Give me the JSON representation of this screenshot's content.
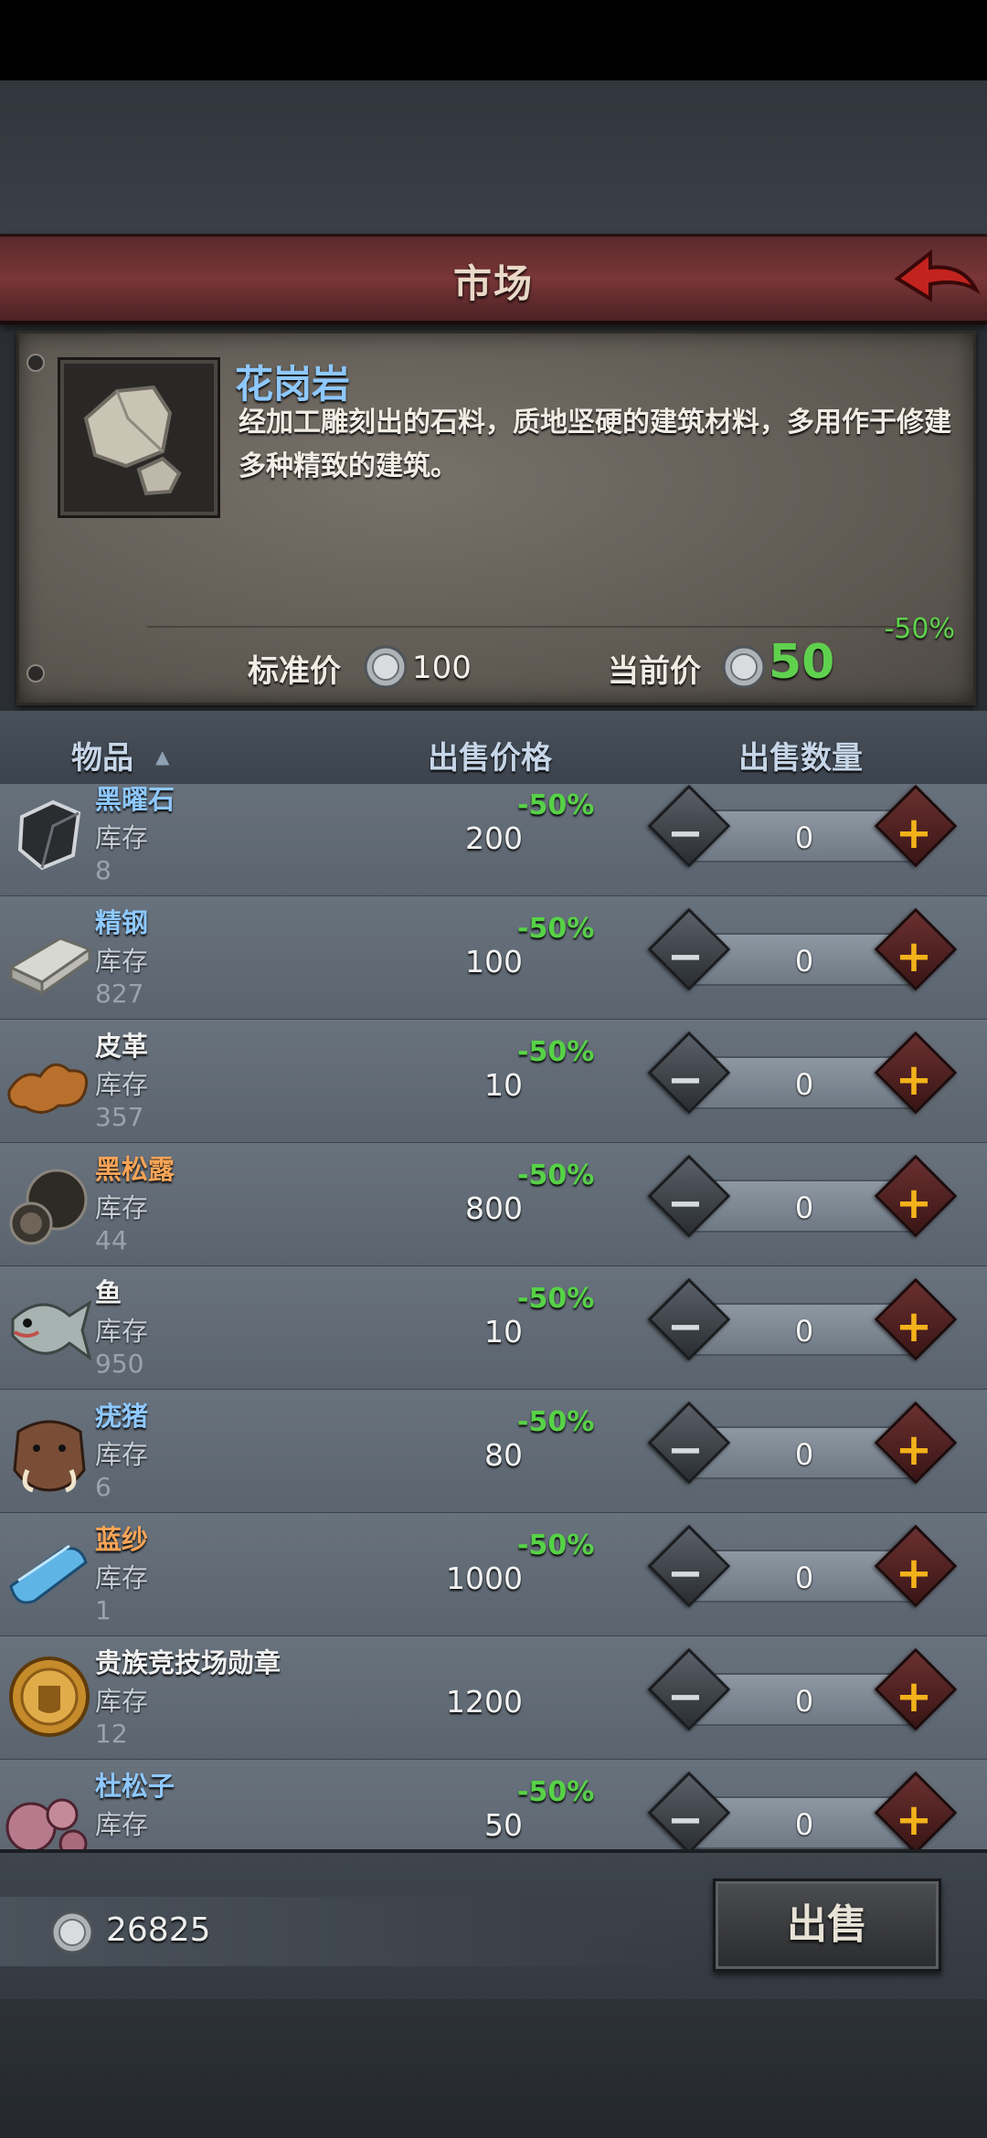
{
  "header": {
    "title": "市场"
  },
  "selected_item": {
    "name": "花岗岩",
    "description": "经加工雕刻出的石料，质地坚硬的建筑材料，多用作于修建多种精致的建筑。",
    "standard_price_label": "标准价",
    "standard_price": "100",
    "current_price_label": "当前价",
    "current_price": "50",
    "discount": "-50%"
  },
  "columns": {
    "item": "物品",
    "sell_price": "出售价格",
    "sell_qty": "出售数量",
    "sort_arrow": "▲"
  },
  "stock_label": "库存",
  "colors": {
    "name_blue": "#8ec8ff",
    "name_orange": "#f7a457",
    "name_white": "#f0f0f0",
    "discount_green": "#57d247",
    "accent_red": "#7a3638"
  },
  "items": [
    {
      "name": "黑曜石",
      "color": "#8ec8ff",
      "stock": "8",
      "discount": "-50%",
      "price": "200",
      "qty": "0",
      "icon": "obsidian-icon"
    },
    {
      "name": "精钢",
      "color": "#8ec8ff",
      "stock": "827",
      "discount": "-50%",
      "price": "100",
      "qty": "0",
      "icon": "steel-ingot-icon"
    },
    {
      "name": "皮革",
      "color": "#f0f0f0",
      "stock": "357",
      "discount": "-50%",
      "price": "10",
      "qty": "0",
      "icon": "leather-icon"
    },
    {
      "name": "黑松露",
      "color": "#f7a457",
      "stock": "44",
      "discount": "-50%",
      "price": "800",
      "qty": "0",
      "icon": "truffle-icon"
    },
    {
      "name": "鱼",
      "color": "#f0f0f0",
      "stock": "950",
      "discount": "-50%",
      "price": "10",
      "qty": "0",
      "icon": "fish-icon"
    },
    {
      "name": "疣猪",
      "color": "#8ec8ff",
      "stock": "6",
      "discount": "-50%",
      "price": "80",
      "qty": "0",
      "icon": "warthog-icon"
    },
    {
      "name": "蓝纱",
      "color": "#f7a457",
      "stock": "1",
      "discount": "-50%",
      "price": "1000",
      "qty": "0",
      "icon": "blue-cloth-icon"
    },
    {
      "name": "贵族竞技场勋章",
      "color": "#f0f0f0",
      "stock": "12",
      "discount": "",
      "price": "1200",
      "qty": "0",
      "icon": "arena-medal-icon"
    },
    {
      "name": "杜松子",
      "color": "#8ec8ff",
      "stock": "",
      "discount": "-50%",
      "price": "50",
      "qty": "0",
      "icon": "juniper-berry-icon"
    }
  ],
  "wallet": {
    "silver": "26825"
  },
  "actions": {
    "sell": "出售"
  }
}
